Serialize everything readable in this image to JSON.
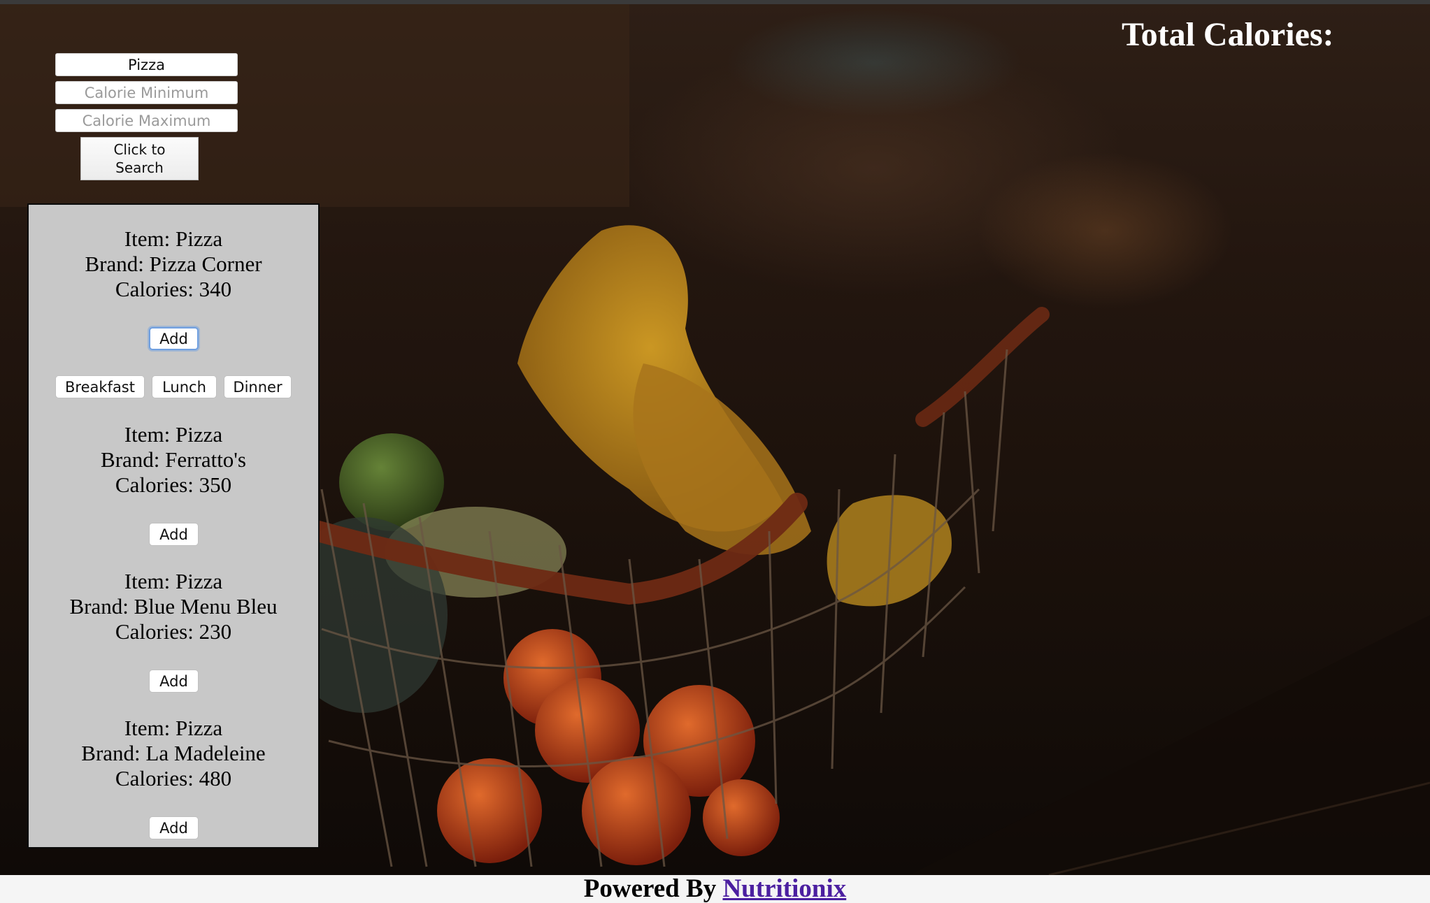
{
  "search": {
    "query_value": "Pizza",
    "calorie_min_placeholder": "Calorie Minimum",
    "calorie_max_placeholder": "Calorie Maximum",
    "button_label": "Click to Search"
  },
  "header": {
    "total_calories_label": "Total Calories:"
  },
  "results": [
    {
      "item": "Item: Pizza",
      "brand": "Brand: Pizza Corner",
      "calories": "Calories: 340",
      "add_label": "Add"
    },
    {
      "item": "Item: Pizza",
      "brand": "Brand: Ferratto's",
      "calories": "Calories: 350",
      "add_label": "Add"
    },
    {
      "item": "Item: Pizza",
      "brand": "Brand: Blue Menu Bleu",
      "calories": "Calories: 230",
      "add_label": "Add"
    },
    {
      "item": "Item: Pizza",
      "brand": "Brand: La Madeleine",
      "calories": "Calories: 480",
      "add_label": "Add"
    }
  ],
  "meal_options": [
    "Breakfast",
    "Lunch",
    "Dinner"
  ],
  "footer": {
    "prefix": "Powered By ",
    "link_text": "Nutritionix"
  },
  "colors": {
    "panel_background": "#c8c8c8",
    "link": "#4b1fa0",
    "focus_ring": "#6f9fe0"
  }
}
